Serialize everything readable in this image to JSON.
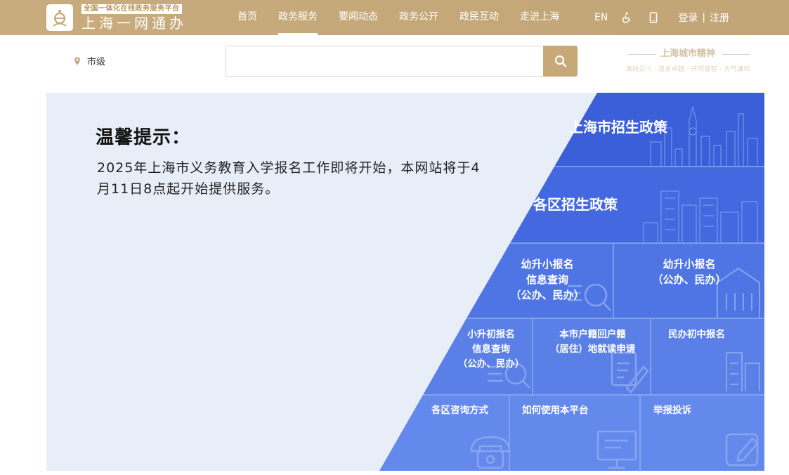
{
  "header": {
    "logo_tag": "全国一体化在线政务服务平台",
    "logo_name": "上海一网通办",
    "nav": [
      "首页",
      "政务服务",
      "要闻动态",
      "政务公开",
      "政民互动",
      "走进上海"
    ],
    "active_nav": "政务服务",
    "lang": "EN",
    "accessibility_icon": "wheelchair-icon",
    "mobile_icon": "mobile-icon",
    "login": "登录",
    "register": "注册",
    "separator": "|"
  },
  "search": {
    "location": "市级",
    "value": ""
  },
  "spirit": {
    "title": "上海城市精神",
    "subtitle": "海纳百川 · 追求卓越 · 开明睿智 · 大气谦和"
  },
  "banner": {
    "notice_title": "温馨提示：",
    "notice_body": "2025年上海市义务教育入学报名工作即将开始，本网站将于4月11日8点起开始提供服务。",
    "tiles": {
      "city_policy": "上海市招生政策",
      "district_policy": "各区招生政策",
      "kinder_query": [
        "幼升小报名",
        "信息查询",
        "（公办、民办）"
      ],
      "kinder_register": [
        "幼升小报名",
        "（公办、民办）"
      ],
      "primary_query": [
        "小升初报名",
        "信息查询",
        "（公办、民办）"
      ],
      "hukou": [
        "本市户籍回户籍",
        "（居住）地就读申请"
      ],
      "private_middle": "民办初中报名",
      "district_contact": "各区咨询方式",
      "how_to_use": "如何使用本平台",
      "report": "举报投诉"
    }
  },
  "colors": {
    "gold": "#c4a97c",
    "blue_dark": "#3a5fd8",
    "blue_mid": "#4770e3",
    "blue_light": "#5d86ea",
    "banner_bg": "#e8eef8"
  }
}
